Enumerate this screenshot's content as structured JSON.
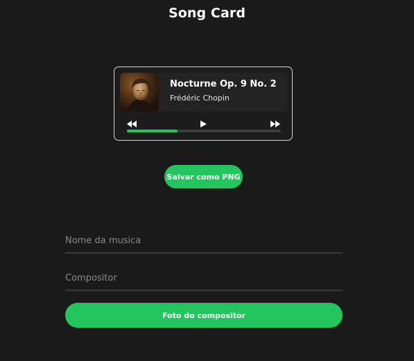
{
  "page": {
    "title": "Song Card"
  },
  "card": {
    "song_title": "Nocturne Op. 9 No. 2",
    "artist": "Frédéric Chopin",
    "cover_icon": "composer-portrait",
    "controls": {
      "rewind_icon": "rewind-icon",
      "play_icon": "play-icon",
      "forward_icon": "fast-forward-icon"
    },
    "progress": 0.33
  },
  "actions": {
    "save_png_label": "Salvar como PNG",
    "photo_label": "Foto do compositor"
  },
  "form": {
    "song_name_placeholder": "Nome da musica",
    "song_name_value": "",
    "composer_placeholder": "Compositor",
    "composer_value": ""
  },
  "colors": {
    "accent": "#22c55e",
    "background": "#1a1a1a",
    "card_border": "#d8d8d8"
  }
}
